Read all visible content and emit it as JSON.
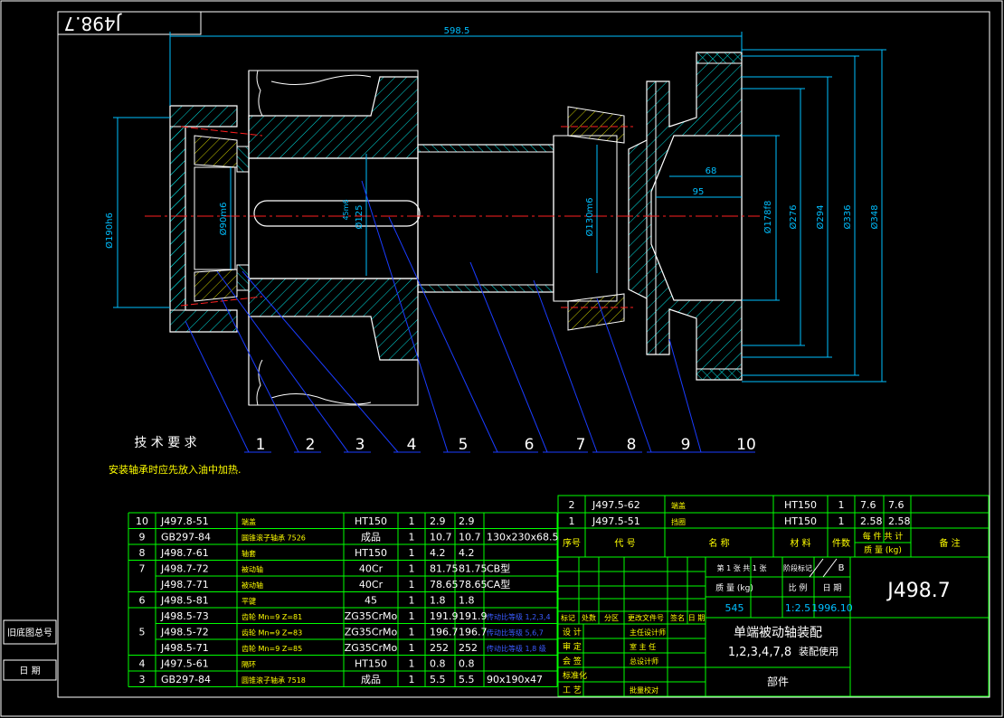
{
  "colors": {
    "background": "#000000",
    "frame": "#ffffff",
    "dimension": "#00bfff",
    "hatch": "#00e0e0",
    "part": "#ffffff",
    "center_line": "#ff2020",
    "leader": "#1a3cff",
    "table_line": "#00ff00",
    "text_white": "#ffffff",
    "text_yellow": "#ffff00",
    "text_cyan": "#00ffff",
    "text_blue": "#3a5cff",
    "text_green": "#00ff00"
  },
  "title_block_top": "J498.7",
  "drawing_number": "J498.7",
  "dimensions": {
    "overall_length": "598.5",
    "d190": "Ø190h6",
    "d90": "Ø90m6",
    "d125": "Ø125",
    "d130": "Ø130m6",
    "d178": "Ø178f8",
    "d276": "Ø276",
    "d294": "Ø294",
    "d336": "Ø336",
    "d348": "Ø348",
    "len68": "68",
    "len95": "95",
    "d45m6": "45m6"
  },
  "balloons": [
    "1",
    "2",
    "3",
    "4",
    "5",
    "6",
    "7",
    "8",
    "9",
    "10"
  ],
  "notes": {
    "title": "技 术 要 求",
    "line1": "安装轴承时应先放入油中加热."
  },
  "small_table": {
    "rows": [
      {
        "no": "2",
        "code": "J497.5-62",
        "name": "端盖",
        "material": "HT150",
        "qty": "1",
        "w1": "7.6",
        "w2": "7.6"
      },
      {
        "no": "1",
        "code": "J497.5-51",
        "name": "挡圈",
        "material": "HT150",
        "qty": "1",
        "w1": "2.58",
        "w2": "2.58"
      }
    ],
    "header": {
      "no": "序号",
      "code": "代   号",
      "name": "名    称",
      "material": "材 料",
      "qty": "件数",
      "weight_top": "每 件  共 计",
      "weight": "质 量  (kg)",
      "remark": "备   注"
    }
  },
  "parts_list": {
    "rows": [
      {
        "no": "10",
        "code": "J497.8-51",
        "name": "端盖",
        "material": "HT150",
        "qty": "1",
        "w1": "2.9",
        "w2": "2.9",
        "remark": ""
      },
      {
        "no": "9",
        "code": "GB297-84",
        "name": "圆锥滚子轴承 7526",
        "material": "成品",
        "qty": "1",
        "w1": "10.7",
        "w2": "10.7",
        "remark": "130x230x68.5"
      },
      {
        "no": "8",
        "code": "J498.7-61",
        "name": "轴套",
        "material": "HT150",
        "qty": "1",
        "w1": "4.2",
        "w2": "4.2",
        "remark": ""
      },
      {
        "no": "",
        "code": "J498.7-72",
        "name": "被动轴",
        "material": "40Cr",
        "qty": "1",
        "w1": "81.75",
        "w2": "81.75",
        "remark": "CB型"
      },
      {
        "no": "",
        "code": "J498.7-71",
        "name": "被动轴",
        "material": "40Cr",
        "qty": "1",
        "w1": "78.65",
        "w2": "78.65",
        "remark": "CA型"
      },
      {
        "no": "6",
        "code": "J498.5-81",
        "name": "平键",
        "material": "45",
        "qty": "1",
        "w1": "1.8",
        "w2": "1.8",
        "remark": ""
      },
      {
        "no": "",
        "code": "J498.5-73",
        "name": "齿轮 Mn=9  Z=81",
        "material": "ZG35CrMo",
        "qty": "1",
        "w1": "191.9",
        "w2": "191.9",
        "remark": "传动比等级 1,2,3,4"
      },
      {
        "no": "",
        "code": "J498.5-72",
        "name": "齿轮 Mn=9  Z=83",
        "material": "ZG35CrMo",
        "qty": "1",
        "w1": "196.7",
        "w2": "196.7",
        "remark": "传动比等级 5,6,7"
      },
      {
        "no": "",
        "code": "J498.5-71",
        "name": "齿轮 Mn=9  Z=85",
        "material": "ZG35CrMo",
        "qty": "1",
        "w1": "252",
        "w2": "252",
        "remark": "传动比等级 1,8 级"
      },
      {
        "no": "4",
        "code": "J497.5-61",
        "name": "隔环",
        "material": "HT150",
        "qty": "1",
        "w1": "0.8",
        "w2": "0.8",
        "remark": ""
      },
      {
        "no": "3",
        "code": "GB297-84",
        "name": "圆锥滚子轴承 7518",
        "material": "成品",
        "qty": "1",
        "w1": "5.5",
        "w2": "5.5",
        "remark": "90x190x47"
      }
    ],
    "merged_no": {
      "7": "7",
      "5": "5"
    }
  },
  "title_block": {
    "sheet": "第 1 张 共 1 张",
    "stage_mark": "阶段标记",
    "mark_b": "B",
    "mass_label": "质 量 (kg)",
    "scale_label": "比 例",
    "date_label": "日 期",
    "mass": "545",
    "scale": "1:2.5",
    "date": "1996.10",
    "rev_headers": [
      "标记",
      "处数",
      "分区",
      "更改文件号",
      "签名",
      "日 期"
    ],
    "roles": [
      "设 计",
      "审 定",
      "会 签",
      "标准化",
      "工 艺"
    ],
    "roles2": [
      "主任设计师",
      "室 主 任",
      "总设计师",
      "",
      "批量校对"
    ],
    "title": "单端被动轴装配",
    "subtitle": "1,2,3,4,7,8",
    "subtitle2": "装配使用",
    "category": "部件"
  },
  "side_labels": {
    "a": "旧底图总号",
    "b": "日 期"
  }
}
